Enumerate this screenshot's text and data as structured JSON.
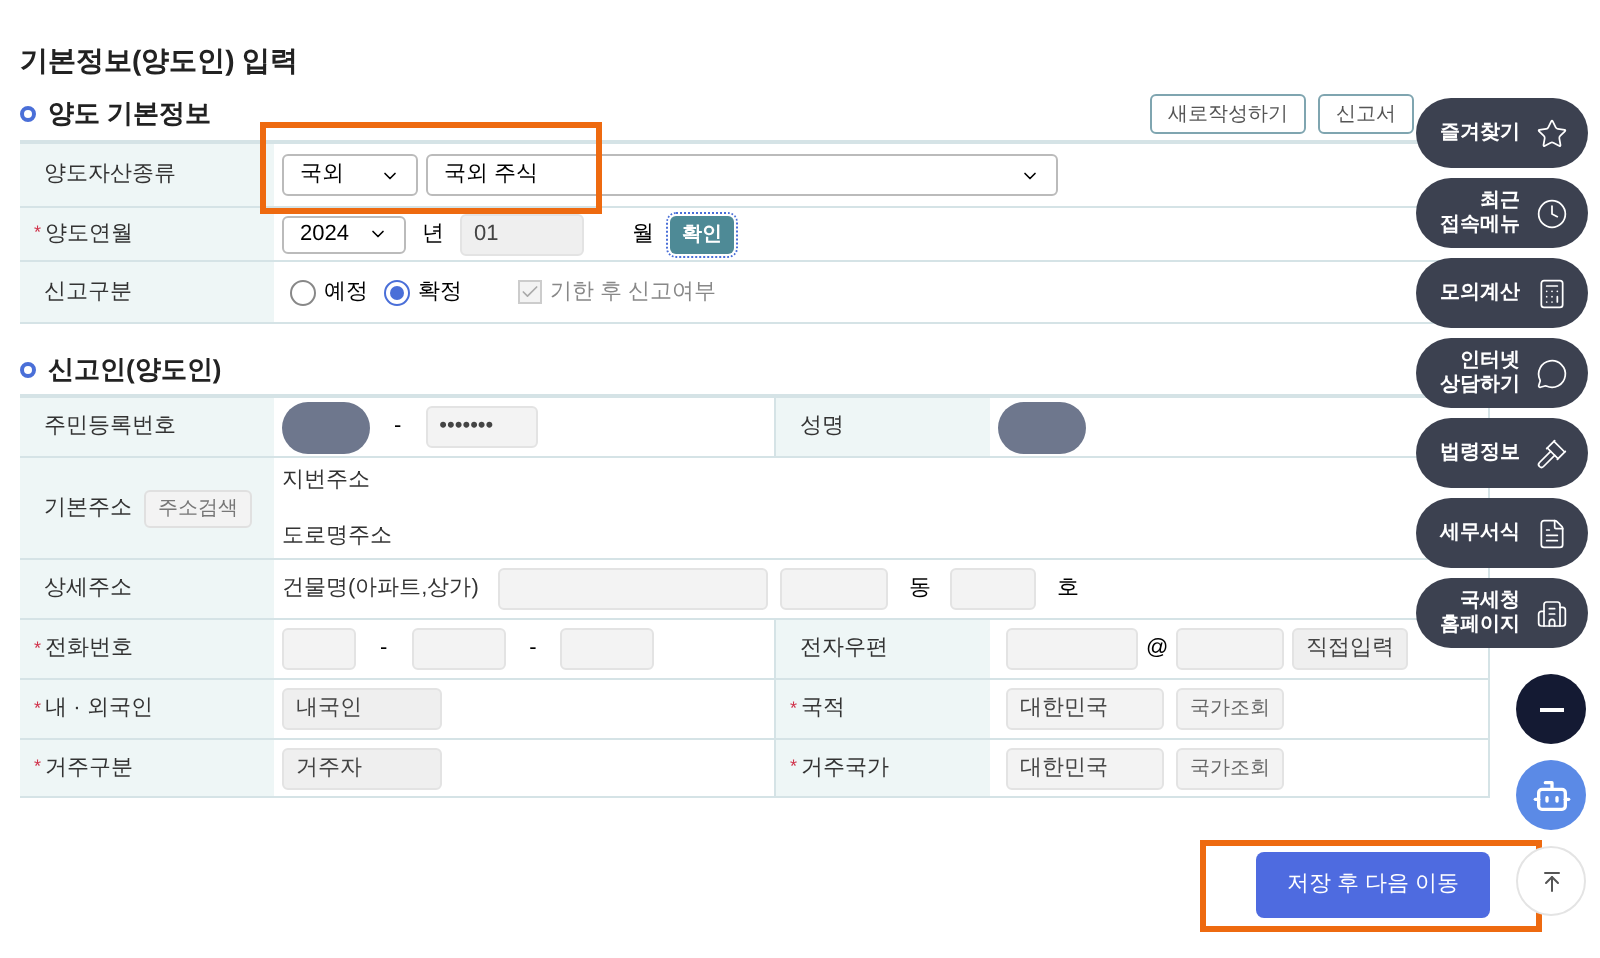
{
  "page_title": "기본정보(양도인) 입력",
  "required_mark": "*",
  "basic_section": {
    "title": "양도 기본정보",
    "buttons": [
      "새로작성하기",
      "신고서"
    ],
    "asset_type": {
      "label": "양도자산종류",
      "required": false,
      "region": "국외",
      "asset": "국외 주식"
    },
    "transfer_month": {
      "label": "양도연월",
      "required": true,
      "year": "2024",
      "year_unit": "년",
      "month": "01",
      "month_unit": "월",
      "confirm": "확인"
    },
    "report_type": {
      "label": "신고구분",
      "required": false,
      "options": [
        {
          "label": "예정",
          "selected": false
        },
        {
          "label": "확정",
          "selected": true
        }
      ],
      "late_report": {
        "label": "기한 후 신고여부",
        "checked": true,
        "disabled": true
      }
    }
  },
  "reporter_section": {
    "title": "신고인(양도인)",
    "resident_no": {
      "label": "주민등록번호",
      "required": false,
      "dash": "-",
      "back": "•••••••"
    },
    "name": {
      "label": "성명",
      "required": false
    },
    "address": {
      "label": "기본주소",
      "required": false,
      "search": "주소검색",
      "lines": [
        "지번주소",
        "도로명주소"
      ]
    },
    "detail_address": {
      "label": "상세주소",
      "required": false,
      "building": "건물명(아파트,상가)",
      "dong": "동",
      "ho": "호"
    },
    "phone": {
      "label": "전화번호",
      "required": true,
      "dash": "-"
    },
    "email": {
      "label": "전자우편",
      "required": false,
      "at": "@",
      "domain": "직접입력"
    },
    "nationality_type": {
      "label": "내 · 외국인",
      "required": true,
      "value": "내국인"
    },
    "nationality": {
      "label": "국적",
      "required": true,
      "value": "대한민국",
      "lookup": "국가조회"
    },
    "residence": {
      "label": "거주구분",
      "required": true,
      "value": "거주자"
    },
    "residence_country": {
      "label": "거주국가",
      "required": true,
      "value": "대한민국",
      "lookup": "국가조회"
    }
  },
  "submit": "저장 후 다음 이동",
  "quick_menu": [
    {
      "label": "즐겨찾기",
      "kind": "star"
    },
    {
      "label": "최근\n접속메뉴",
      "kind": "clock"
    },
    {
      "label": "모의계산",
      "kind": "calc"
    },
    {
      "label": "인터넷\n상담하기",
      "kind": "chat"
    },
    {
      "label": "법령정보",
      "kind": "gavel"
    },
    {
      "label": "세무서식",
      "kind": "doc"
    },
    {
      "label": "국세청\n홈페이지",
      "kind": "building"
    }
  ]
}
